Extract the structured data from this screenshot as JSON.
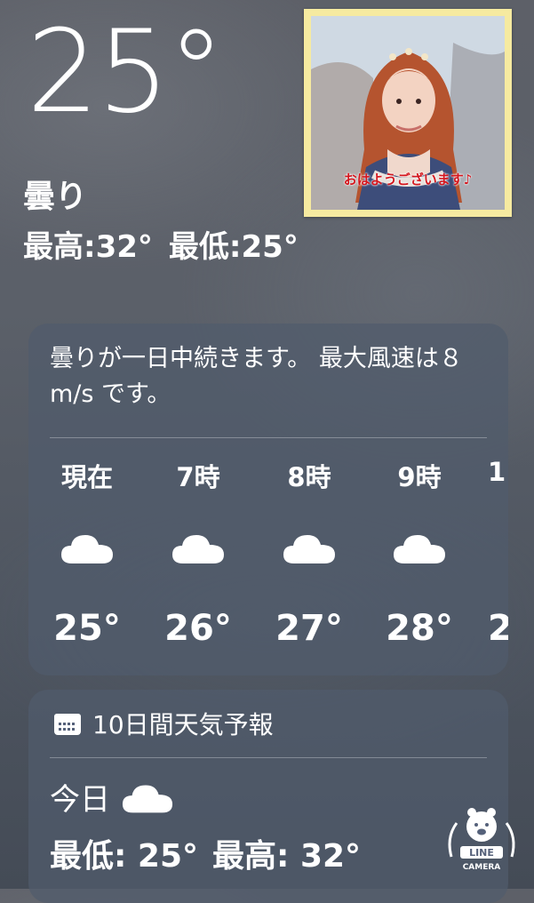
{
  "current": {
    "temperature": "25°",
    "condition": "曇り",
    "high": "最高:32°",
    "low": "最低:25°"
  },
  "sticker": {
    "caption": "おはようございます♪"
  },
  "forecast": {
    "summary": "曇りが一日中続きます。 最大風速は８ m/s です。",
    "hours": [
      {
        "label": "現在",
        "icon": "cloud-icon",
        "temp": "25°"
      },
      {
        "label": "7時",
        "icon": "cloud-icon",
        "temp": "26°"
      },
      {
        "label": "8時",
        "icon": "cloud-icon",
        "temp": "27°"
      },
      {
        "label": "9時",
        "icon": "cloud-icon",
        "temp": "28°"
      },
      {
        "label": "1",
        "icon": "cloud-icon",
        "temp": "2"
      }
    ]
  },
  "daily": {
    "header": "10日間天気予報",
    "header_icon": "calendar-icon",
    "days": [
      {
        "label": "今日",
        "icon": "cloud-icon",
        "low": "最低: 25°",
        "high": "最高: 32°"
      }
    ]
  },
  "watermark": {
    "line1": "LINE",
    "line2": "CAMERA"
  }
}
